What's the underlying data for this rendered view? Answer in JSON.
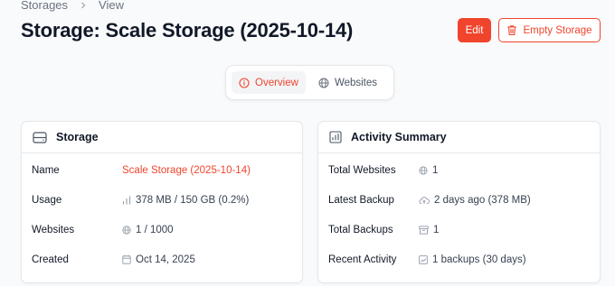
{
  "breadcrumb": {
    "root": "Storages",
    "current": "View"
  },
  "page_title": "Storage: Scale Storage (2025-10-14)",
  "actions": {
    "edit_label": "Edit",
    "empty_label": "Empty Storage"
  },
  "tabs": [
    {
      "label": "Overview",
      "icon": "info-icon",
      "active": true
    },
    {
      "label": "Websites",
      "icon": "globe-icon",
      "active": false
    }
  ],
  "storage_card": {
    "title": "Storage",
    "rows": [
      {
        "label": "Name",
        "value": "Scale Storage (2025-10-14)"
      },
      {
        "label": "Usage",
        "value": "378 MB / 150 GB (0.2%)"
      },
      {
        "label": "Websites",
        "value": "1 / 1000"
      },
      {
        "label": "Created",
        "value": "Oct 14, 2025"
      }
    ]
  },
  "activity_card": {
    "title": "Activity Summary",
    "rows": [
      {
        "label": "Total Websites",
        "value": "1"
      },
      {
        "label": "Latest Backup",
        "value": "2 days ago (378 MB)"
      },
      {
        "label": "Total Backups",
        "value": "1"
      },
      {
        "label": "Recent Activity",
        "value": "1 backups (30 days)"
      }
    ]
  },
  "colors": {
    "accent": "#f0442c",
    "text": "#111827",
    "muted": "#6b7280",
    "border": "#e5e7eb"
  }
}
